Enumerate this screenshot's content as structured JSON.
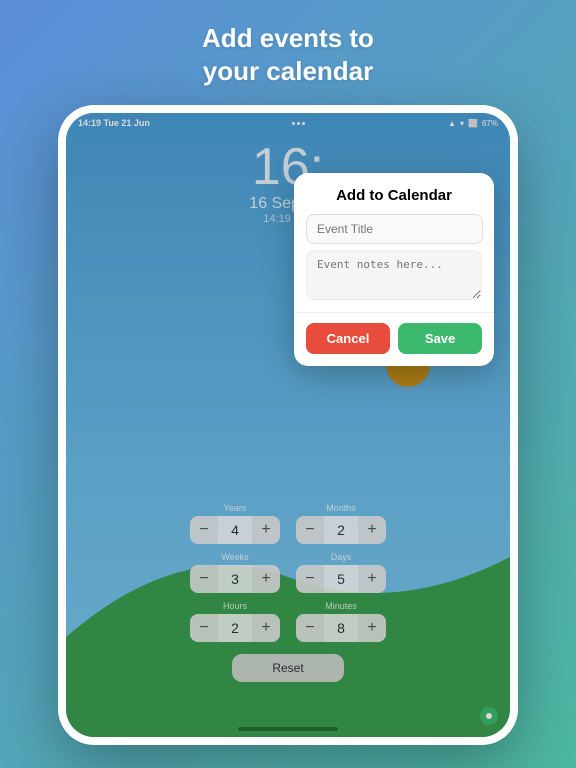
{
  "page": {
    "title_line1": "Add events to",
    "title_line2": "your calendar"
  },
  "status_bar": {
    "time": "14:19",
    "date": "Tue 21 Jun",
    "wifi": "67%"
  },
  "clock": {
    "large": "16:",
    "date": "16 Septem",
    "sub": "14:19 - 21"
  },
  "modal": {
    "title": "Add to Calendar",
    "event_title_placeholder": "Event Title",
    "event_notes_placeholder": "Event notes here...",
    "cancel_label": "Cancel",
    "save_label": "Save"
  },
  "controls": {
    "rows": [
      [
        {
          "label": "Years",
          "value": "4"
        },
        {
          "label": "Months",
          "value": "2"
        }
      ],
      [
        {
          "label": "Weeks",
          "value": "3"
        },
        {
          "label": "Days",
          "value": "5"
        }
      ],
      [
        {
          "label": "Hours",
          "value": "2"
        },
        {
          "label": "Minutes",
          "value": "8"
        }
      ]
    ],
    "reset_label": "Reset"
  }
}
